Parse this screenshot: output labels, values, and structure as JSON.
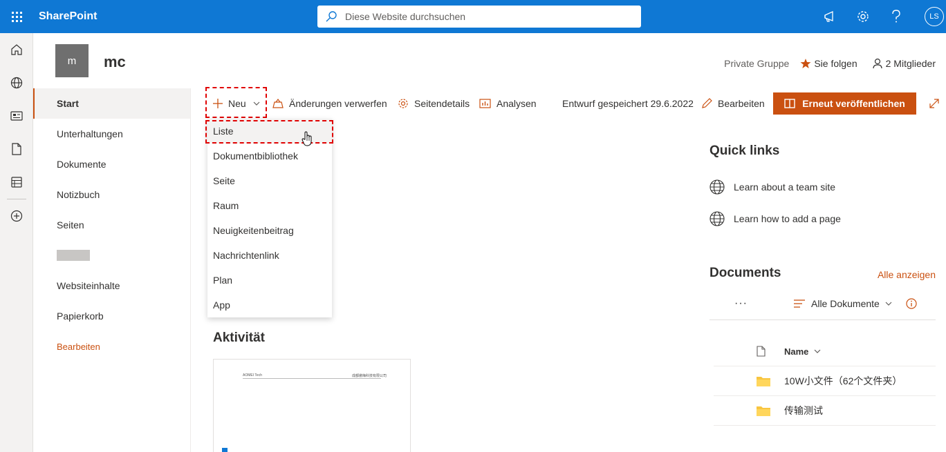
{
  "suite": {
    "brand": "SharePoint",
    "search_placeholder": "Diese Website durchsuchen",
    "avatar_initials": "LS"
  },
  "site": {
    "logo_letter": "m",
    "title": "mc",
    "privacy": "Private Gruppe",
    "follow_label": "Sie folgen",
    "members_label": "2 Mitglieder"
  },
  "nav": {
    "items": [
      {
        "label": "Start"
      },
      {
        "label": "Unterhaltungen"
      },
      {
        "label": "Dokumente"
      },
      {
        "label": "Notizbuch"
      },
      {
        "label": "Seiten"
      },
      {
        "label": "Websiteinhalte"
      },
      {
        "label": "Papierkorb"
      },
      {
        "label": "Bearbeiten"
      }
    ]
  },
  "commandbar": {
    "new_label": "Neu",
    "discard_label": "Änderungen verwerfen",
    "page_details_label": "Seitendetails",
    "analytics_label": "Analysen",
    "draft_status": "Entwurf gespeichert 29.6.2022",
    "edit_label": "Bearbeiten",
    "republish_label": "Erneut veröffentlichen"
  },
  "new_menu": {
    "items": [
      {
        "label": "Liste"
      },
      {
        "label": "Dokumentbibliothek"
      },
      {
        "label": "Seite"
      },
      {
        "label": "Raum"
      },
      {
        "label": "Neuigkeitenbeitrag"
      },
      {
        "label": "Nachrichtenlink"
      },
      {
        "label": "Plan"
      },
      {
        "label": "App"
      }
    ]
  },
  "activity": {
    "title": "Aktivität",
    "thumb_left": "AOMEI Tech",
    "thumb_right": "成都傲梅科技有限公司"
  },
  "quick_links": {
    "title": "Quick links",
    "items": [
      {
        "label": "Learn about a team site"
      },
      {
        "label": "Learn how to add a page"
      }
    ]
  },
  "documents": {
    "title": "Documents",
    "see_all": "Alle anzeigen",
    "more": "···",
    "view_label": "Alle Dokumente",
    "column_name": "Name",
    "rows": [
      {
        "name": "10W小文件（62个文件夹）"
      },
      {
        "name": "传输测试"
      }
    ]
  },
  "colors": {
    "suite_blue": "#0f78d4",
    "accent_orange": "#ca5010",
    "highlight_red": "#e00000"
  }
}
